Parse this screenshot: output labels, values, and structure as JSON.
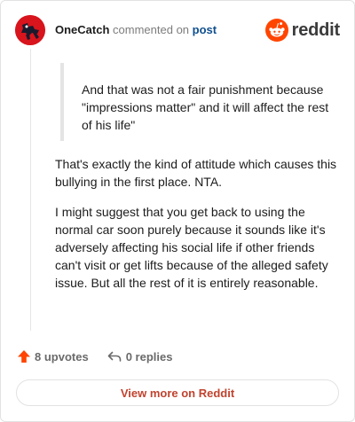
{
  "header": {
    "username": "OneCatch",
    "commented_on": "commented on",
    "post_link": "post",
    "brand_word": "reddit",
    "brand_color": "#ff4500",
    "avatar_icon": "snoo-avatar-icon"
  },
  "comment": {
    "quote": "And that was not a fair punishment because \"impressions matter\" and it will affect the rest of his life\"",
    "paragraphs": [
      "That's exactly the kind of attitude which causes this bullying in the first place. NTA.",
      "I might suggest that you get back to using the normal car soon purely because it sounds like it's adversely affecting his social life if other friends can't visit or get lifts because of the alleged safety issue. But all the rest of it is entirely reasonable."
    ]
  },
  "actions": {
    "upvotes": "8 upvotes",
    "replies": "0 replies",
    "upvote_color": "#ff4500"
  },
  "footer": {
    "view_more": "View more on Reddit"
  }
}
